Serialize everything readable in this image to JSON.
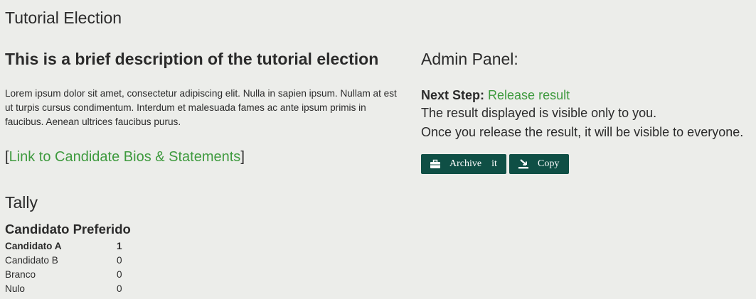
{
  "page": {
    "title": "Tutorial Election"
  },
  "description": {
    "heading_prefix": "This is a brief description of the ",
    "heading_bold": "tutorial election",
    "body": "Lorem ipsum dolor sit amet, consectetur adipiscing elit. Nulla in sapien ipsum. Nullam at est ut turpis cursus condimentum. Interdum et malesuada fames ac ante ipsum primis in faucibus. Aenean ultrices faucibus purus.",
    "bios_open": "[",
    "bios_link": "Link to Candidate Bios & Statements",
    "bios_close": "]"
  },
  "tally": {
    "title": "Tally",
    "question": "Candidato Preferido",
    "rows": [
      {
        "name": "Candidato A",
        "votes": "1"
      },
      {
        "name": "Candidato B",
        "votes": "0"
      },
      {
        "name": "Branco",
        "votes": "0"
      },
      {
        "name": "Nulo",
        "votes": "0"
      }
    ]
  },
  "admin": {
    "title": "Admin Panel:",
    "next_step_label": "Next Step:",
    "next_step_value": "Release result",
    "info_1": "The result displayed is visible only to you.",
    "info_2": "Once you release the result, it will be visible to everyone.",
    "archive_label": "Archive    it",
    "copy_label": "Copy"
  },
  "colors": {
    "background": "#ecedea",
    "accent_green": "#3e9a3e",
    "button_bg": "#0f4f45"
  },
  "icons": {
    "archive": "briefcase-icon",
    "copy": "download-tray-icon"
  }
}
